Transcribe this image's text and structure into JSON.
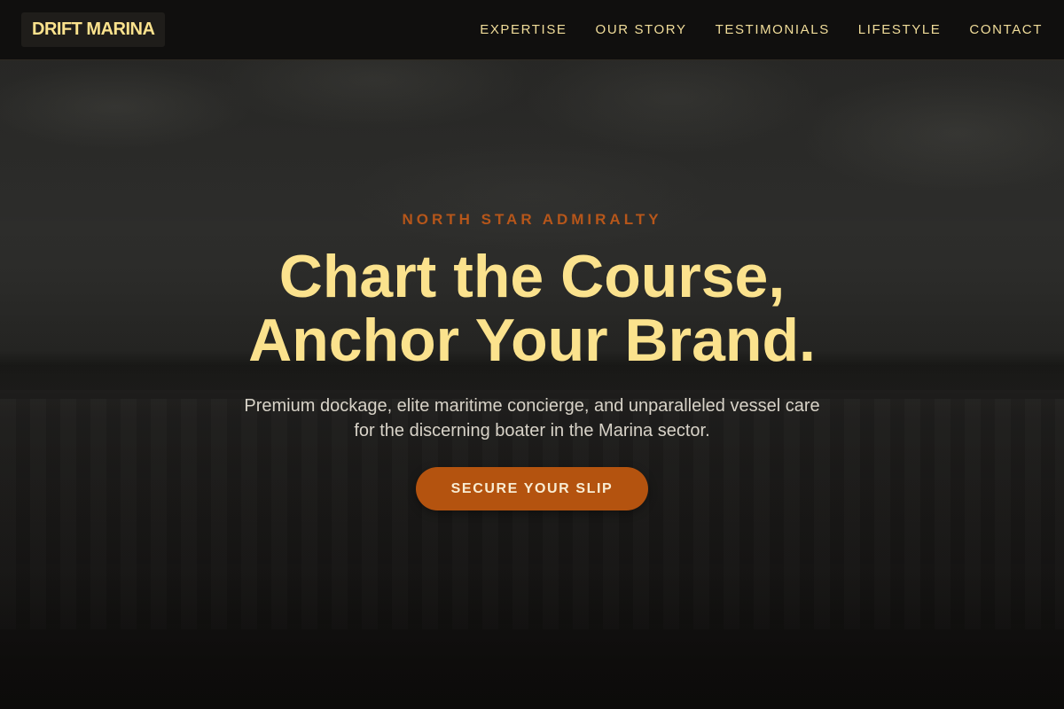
{
  "header": {
    "logo": "DRIFT MARINA",
    "nav": [
      "EXPERTISE",
      "OUR STORY",
      "TESTIMONIALS",
      "LIFESTYLE",
      "CONTACT"
    ]
  },
  "hero": {
    "eyebrow": "NORTH STAR ADMIRALTY",
    "headline_line1": "Chart the Course,",
    "headline_line2": "Anchor Your Brand.",
    "subtitle": "Premium dockage, elite maritime concierge, and unparalleled vessel care for the discerning boater in the Marina sector.",
    "cta_label": "SECURE YOUR SLIP"
  },
  "colors": {
    "accent_gold": "#fbe28d",
    "accent_orange": "#b4530f",
    "background": "#0f0e0d"
  }
}
